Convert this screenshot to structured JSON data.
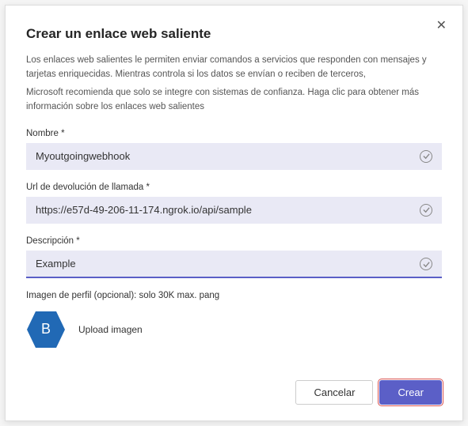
{
  "dialog": {
    "title": "Crear un enlace web saliente",
    "description1": "Los enlaces web salientes le permiten enviar comandos a servicios que responden con mensajes y tarjetas enriquecidas.              Mientras controla si los datos se envían o reciben de terceros,",
    "description2": "Microsoft recomienda que solo se integre con sistemas de confianza. Haga clic para obtener más información sobre los enlaces web salientes"
  },
  "fields": {
    "name": {
      "label": "Nombre *",
      "value": "Myoutgoingwebhook"
    },
    "url": {
      "label": "Url de devolución de llamada *",
      "value": "https://e57d-49-206-11-174.ngrok.io/api/sample"
    },
    "desc": {
      "label": "Descripción   *",
      "value": "Example"
    },
    "avatar": {
      "label": "Imagen de perfil (opcional): solo 30K max. pang",
      "letter": "B",
      "upload": "Upload imagen"
    }
  },
  "buttons": {
    "cancel": "Cancelar",
    "create": "Crear"
  },
  "colors": {
    "primary": "#5b5fc7",
    "avatarBg": "#2169b5"
  }
}
